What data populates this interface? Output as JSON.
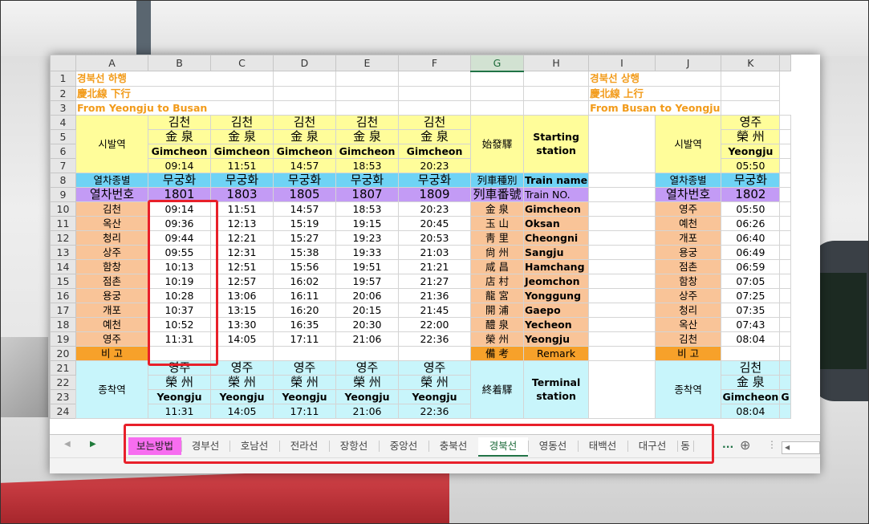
{
  "columns": [
    "A",
    "B",
    "C",
    "D",
    "E",
    "F",
    "G",
    "H",
    "I",
    "J",
    "K"
  ],
  "rows": [
    "1",
    "2",
    "3",
    "4",
    "5",
    "6",
    "7",
    "8",
    "9",
    "10",
    "11",
    "12",
    "13",
    "14",
    "15",
    "16",
    "17",
    "18",
    "19",
    "20",
    "21",
    "22",
    "23",
    "24"
  ],
  "left_titles": [
    "경북선 하행",
    "慶北線 下行",
    "From Yeongju to Busan"
  ],
  "right_titles": [
    "경북선 상행",
    "慶北線 上行",
    "From Busan to Yeongju"
  ],
  "origin": {
    "label": "시발역",
    "kr": [
      "김천",
      "김천",
      "김천",
      "김천",
      "김천"
    ],
    "hanja": [
      "金 泉",
      "金 泉",
      "金 泉",
      "金 泉",
      "金 泉"
    ],
    "en": [
      "Gimcheon",
      "Gimcheon",
      "Gimcheon",
      "Gimcheon",
      "Gimcheon"
    ],
    "time": [
      "09:14",
      "11:51",
      "14:57",
      "18:53",
      "20:23"
    ],
    "hanja_label": "始發驛",
    "en_label": "Starting station"
  },
  "train_type": {
    "label": "열차종별",
    "values": [
      "무궁화",
      "무궁화",
      "무궁화",
      "무궁화",
      "무궁화"
    ],
    "hanja": "列車種別",
    "en": "Train name"
  },
  "train_no": {
    "label": "열차번호",
    "values": [
      "1801",
      "1803",
      "1805",
      "1807",
      "1809"
    ],
    "hanja": "列車番號",
    "en": "Train NO."
  },
  "stations": [
    {
      "kr": "김천",
      "t": [
        "09:14",
        "11:51",
        "14:57",
        "18:53",
        "20:23"
      ],
      "hanja": "金 泉",
      "en": "Gimcheon"
    },
    {
      "kr": "옥산",
      "t": [
        "09:36",
        "12:13",
        "15:19",
        "19:15",
        "20:45"
      ],
      "hanja": "玉 山",
      "en": "Oksan"
    },
    {
      "kr": "청리",
      "t": [
        "09:44",
        "12:21",
        "15:27",
        "19:23",
        "20:53"
      ],
      "hanja": "靑 里",
      "en": "Cheongni"
    },
    {
      "kr": "상주",
      "t": [
        "09:55",
        "12:31",
        "15:38",
        "19:33",
        "21:03"
      ],
      "hanja": "尙 州",
      "en": "Sangju"
    },
    {
      "kr": "함창",
      "t": [
        "10:13",
        "12:51",
        "15:56",
        "19:51",
        "21:21"
      ],
      "hanja": "咸 昌",
      "en": "Hamchang"
    },
    {
      "kr": "점촌",
      "t": [
        "10:19",
        "12:57",
        "16:02",
        "19:57",
        "21:27"
      ],
      "hanja": "店 村",
      "en": "Jeomchon"
    },
    {
      "kr": "용궁",
      "t": [
        "10:28",
        "13:06",
        "16:11",
        "20:06",
        "21:36"
      ],
      "hanja": "龍 宮",
      "en": "Yonggung"
    },
    {
      "kr": "개포",
      "t": [
        "10:37",
        "13:15",
        "16:20",
        "20:15",
        "21:45"
      ],
      "hanja": "開 浦",
      "en": "Gaepo"
    },
    {
      "kr": "예천",
      "t": [
        "10:52",
        "13:30",
        "16:35",
        "20:30",
        "22:00"
      ],
      "hanja": "醴 泉",
      "en": "Yecheon"
    },
    {
      "kr": "영주",
      "t": [
        "11:31",
        "14:05",
        "17:11",
        "21:06",
        "22:36"
      ],
      "hanja": "榮 州",
      "en": "Yeongju"
    }
  ],
  "remark": {
    "label": "비 고",
    "hanja": "備 考",
    "en": "Remark"
  },
  "terminal": {
    "label": "종착역",
    "kr": [
      "영주",
      "영주",
      "영주",
      "영주",
      "영주"
    ],
    "hanja": [
      "榮 州",
      "榮 州",
      "榮 州",
      "榮 州",
      "榮 州"
    ],
    "en": [
      "Yeongju",
      "Yeongju",
      "Yeongju",
      "Yeongju",
      "Yeongju"
    ],
    "time": [
      "11:31",
      "14:05",
      "17:11",
      "21:06",
      "22:36"
    ],
    "hanja_label": "終着驛",
    "en_label": "Terminal station"
  },
  "right": {
    "origin": {
      "label": "시발역",
      "kr": "영주",
      "hanja": "榮 州",
      "en": "Yeongju",
      "time": "05:50"
    },
    "train_type": {
      "label": "열차종별",
      "value": "무궁화"
    },
    "train_no": {
      "label": "열차번호",
      "value": "1802"
    },
    "stations": [
      {
        "kr": "영주",
        "t": "05:50"
      },
      {
        "kr": "예천",
        "t": "06:26"
      },
      {
        "kr": "개포",
        "t": "06:40"
      },
      {
        "kr": "용궁",
        "t": "06:49"
      },
      {
        "kr": "점촌",
        "t": "06:59"
      },
      {
        "kr": "함창",
        "t": "07:05"
      },
      {
        "kr": "상주",
        "t": "07:25"
      },
      {
        "kr": "청리",
        "t": "07:35"
      },
      {
        "kr": "옥산",
        "t": "07:43"
      },
      {
        "kr": "김천",
        "t": "08:04"
      }
    ],
    "remark": "비 고",
    "terminal": {
      "label": "종착역",
      "kr": "김천",
      "hanja": "金 泉",
      "en": "Gimcheon",
      "time": "08:04",
      "extra": "G"
    }
  },
  "tabs": [
    "보는방법",
    "경부선",
    "호남선",
    "전라선",
    "장항선",
    "중앙선",
    "충북선",
    "경북선",
    "영동선",
    "태백선",
    "대구선",
    "동"
  ],
  "active_tab": "경북선",
  "tab_more": "...",
  "add_sheet": "⊕",
  "tab_menu": "⋮",
  "colors": {
    "title": "#f29b1a",
    "yellow": "#fffd9a",
    "blue": "#6fd3f5",
    "purple": "#c39bf5",
    "orange": "#f9c498",
    "darkorange": "#f7a12a",
    "cyan": "#c8f5fb",
    "highlight": "#e8202a",
    "tab_pink": "#f76df0",
    "excel_green": "#217346"
  }
}
